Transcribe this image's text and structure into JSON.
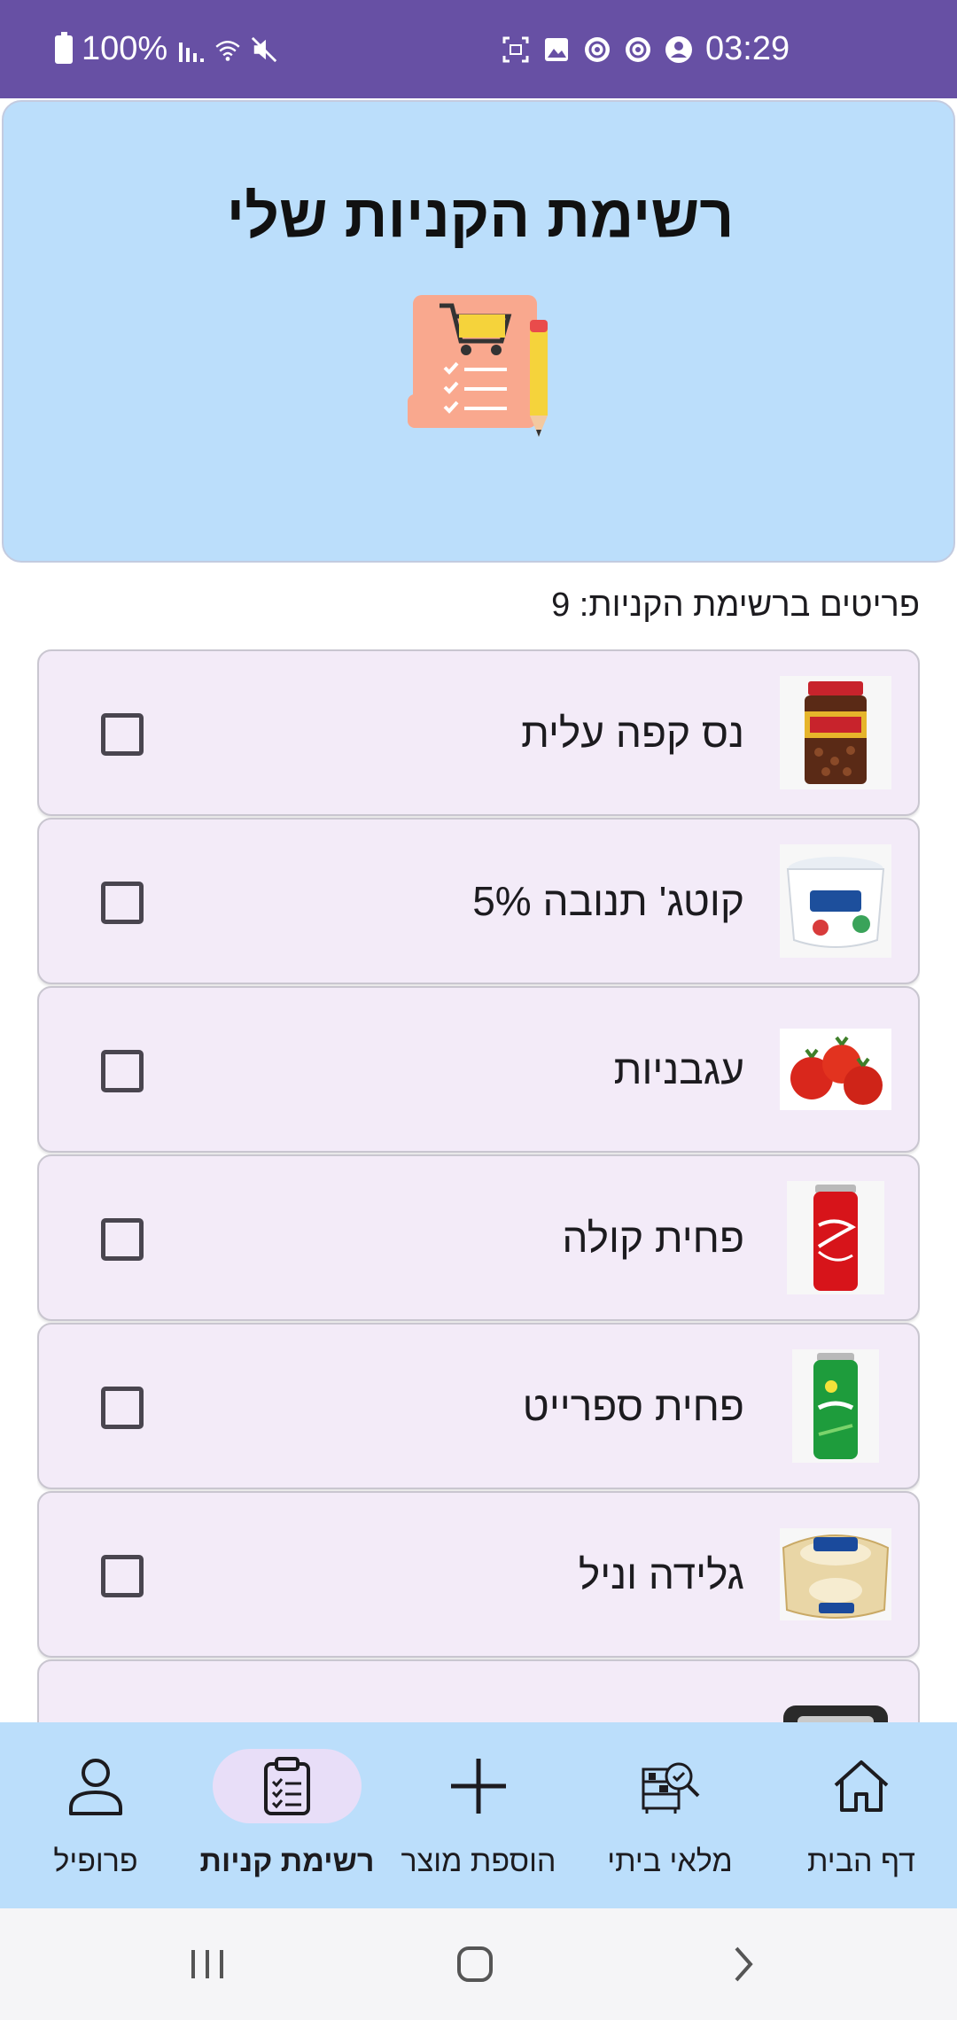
{
  "status_bar": {
    "battery": "100%",
    "time": "03:29"
  },
  "header": {
    "title": "רשימת הקניות שלי",
    "art_icon": "shopping-list-icon"
  },
  "summary": {
    "count_text": "פריטים ברשימת הקניות: 9"
  },
  "items": [
    {
      "label": "נס קפה עלית",
      "image": "coffee-jar-image",
      "checked": false
    },
    {
      "label": "קוטג' תנובה 5%",
      "image": "cottage-cheese-image",
      "checked": false
    },
    {
      "label": "עגבניות",
      "image": "tomatoes-image",
      "checked": false
    },
    {
      "label": "פחית קולה",
      "image": "cola-can-image",
      "checked": false
    },
    {
      "label": "פחית ספרייט",
      "image": "sprite-can-image",
      "checked": false
    },
    {
      "label": "גלידה וניל",
      "image": "ice-cream-image",
      "checked": false
    },
    {
      "label": "",
      "image": "product-image",
      "checked": false
    }
  ],
  "bottom_nav": [
    {
      "label": "דף הבית",
      "icon": "home-icon",
      "active": false
    },
    {
      "label": "מלאי ביתי",
      "icon": "inventory-icon",
      "active": false
    },
    {
      "label": "הוספת מוצר",
      "icon": "plus-icon",
      "active": false
    },
    {
      "label": "רשימת קניות",
      "icon": "clipboard-list-icon",
      "active": true
    },
    {
      "label": "פרופיל",
      "icon": "person-icon",
      "active": false
    }
  ],
  "colors": {
    "status_bar": "#6750a4",
    "header_bg": "#bbdefb",
    "card_bg": "#f3ebf8",
    "nav_bg": "#bbdefb",
    "nav_active_pill": "#e8def8"
  }
}
